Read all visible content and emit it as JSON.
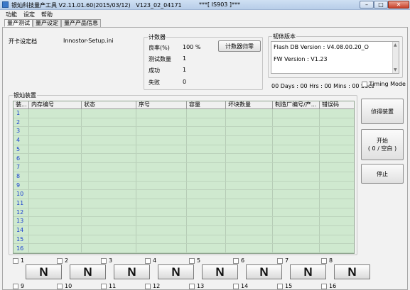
{
  "window": {
    "title": "银灿科技量产工具 V2.11.01.60(2015/03/12)   V123_02_04171",
    "center_title": "***[ IS903 ]***"
  },
  "menu": [
    "功能",
    "设定",
    "帮助"
  ],
  "tabs": [
    "量产测试",
    "量产设定",
    "量产产品信息"
  ],
  "card_setting": {
    "label": "开卡设定档",
    "value": "Innostor-Setup.ini"
  },
  "counter": {
    "title": "计数器",
    "rows": [
      {
        "label": "良率(%)",
        "value": "100 %"
      },
      {
        "label": "测试数量",
        "value": "1"
      },
      {
        "label": "成功",
        "value": "1"
      },
      {
        "label": "失败",
        "value": "0"
      }
    ],
    "reset_button": "计数器归零"
  },
  "firmware": {
    "title": "韧体版本",
    "flash_db": "Flash DB Version :  V4.08.00.20_O",
    "fw": "FW Version :    V1.23"
  },
  "elapsed": "00 Days : 00 Hrs : 00 Mins : 00 Secs",
  "timing_mode": "Timing Mode",
  "device_group": "银灿装置",
  "grid": {
    "columns": [
      "装...",
      "内存编号",
      "状态",
      "序号",
      "容量",
      "坏块数量",
      "制造厂编号/产...",
      "错误码"
    ],
    "rows": [
      "1",
      "2",
      "3",
      "4",
      "5",
      "6",
      "7",
      "8",
      "9",
      "10",
      "11",
      "12",
      "13",
      "14",
      "15",
      "16"
    ]
  },
  "buttons": {
    "scan": "侦得装置",
    "start_line1": "开始",
    "start_line2": "( 0 / 空白 )",
    "stop": "停止"
  },
  "ports": {
    "row1": [
      "1",
      "2",
      "3",
      "4",
      "5",
      "6",
      "7",
      "8"
    ],
    "row2": [
      "9",
      "10",
      "11",
      "12",
      "13",
      "14",
      "15",
      "16"
    ],
    "status_letter": "N"
  }
}
